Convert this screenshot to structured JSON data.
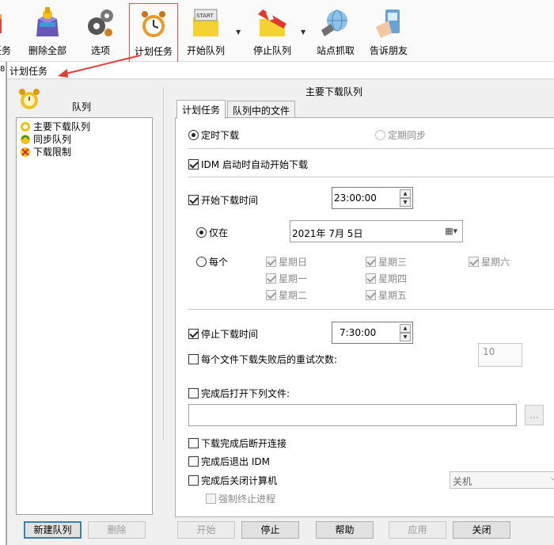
{
  "toolbar": {
    "items": [
      {
        "label": "任务",
        "icon": "task-icon"
      },
      {
        "label": "删除全部",
        "icon": "delete-all-box-icon"
      },
      {
        "label": "选项",
        "icon": "gears-icon"
      },
      {
        "label": "计划任务",
        "icon": "alarm-clock-icon"
      },
      {
        "label": "开始队列",
        "icon": "start-queue-folder-icon"
      },
      {
        "label": "停止队列",
        "icon": "stop-queue-folder-icon"
      },
      {
        "label": "站点抓取",
        "icon": "site-grabber-globe-icon"
      },
      {
        "label": "告诉朋友",
        "icon": "tell-friend-phone-icon"
      }
    ]
  },
  "dialog": {
    "title": "计划任务",
    "left_marker": "8"
  },
  "left": {
    "title": "队列",
    "queues": [
      {
        "label": "主要下载队列",
        "icon": "queue-icon"
      },
      {
        "label": "同步队列",
        "icon": "sync-queue-icon"
      },
      {
        "label": "下载限制",
        "icon": "limit-queue-icon"
      }
    ],
    "new_button": "新建队列",
    "delete_button": "删除"
  },
  "right": {
    "title": "主要下载队列",
    "tabs": [
      "计划任务",
      "队列中的文件"
    ],
    "timed_download": "定时下载",
    "periodic_sync": "定期同步",
    "auto_start": "IDM 启动时自动开始下载",
    "start_time_label": "开始下载时间",
    "start_time": "23:00:00",
    "once_label": "仅在",
    "date": "2021年  7月  5日",
    "every_label": "每个",
    "weekdays": [
      "星期日",
      "星期一",
      "星期二",
      "星期三",
      "星期四",
      "星期五",
      "星期六"
    ],
    "stop_time_label": "停止下载时间",
    "stop_time": "7:30:00",
    "retry_label": "每个文件下载失败后的重试次数:",
    "retry_count": "10",
    "open_file_label": "完成后打开下列文件:",
    "browse": "...",
    "hangup_label": "下载完成后断开连接",
    "exit_idm_label": "完成后退出 IDM",
    "shutdown_label": "完成后关闭计算机",
    "shutdown_mode": "关机",
    "force_kill_label": "强制终止进程"
  },
  "footer": {
    "start": "开始",
    "stop": "停止",
    "help": "帮助",
    "apply": "应用",
    "close": "关闭"
  }
}
